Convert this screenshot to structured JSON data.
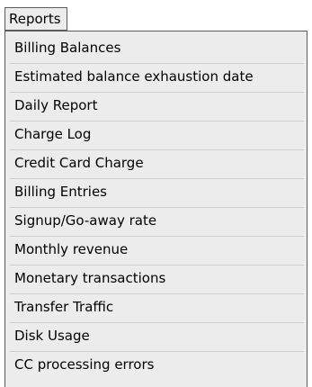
{
  "menubar": {
    "title": "Reports"
  },
  "menu": {
    "items": [
      {
        "label": "Billing Balances"
      },
      {
        "label": "Estimated balance exhaustion date"
      },
      {
        "label": "Daily Report"
      },
      {
        "label": "Charge Log"
      },
      {
        "label": "Credit Card Charge"
      },
      {
        "label": "Billing Entries"
      },
      {
        "label": "Signup/Go-away rate"
      },
      {
        "label": "Monthly revenue"
      },
      {
        "label": "Monetary transactions"
      },
      {
        "label": "Transfer Traffic"
      },
      {
        "label": "Disk Usage"
      },
      {
        "label": "CC processing errors"
      }
    ]
  },
  "colors": {
    "menu_background": "#ececec",
    "border": "#5c5c5c",
    "separator": "#cdcdcd"
  }
}
